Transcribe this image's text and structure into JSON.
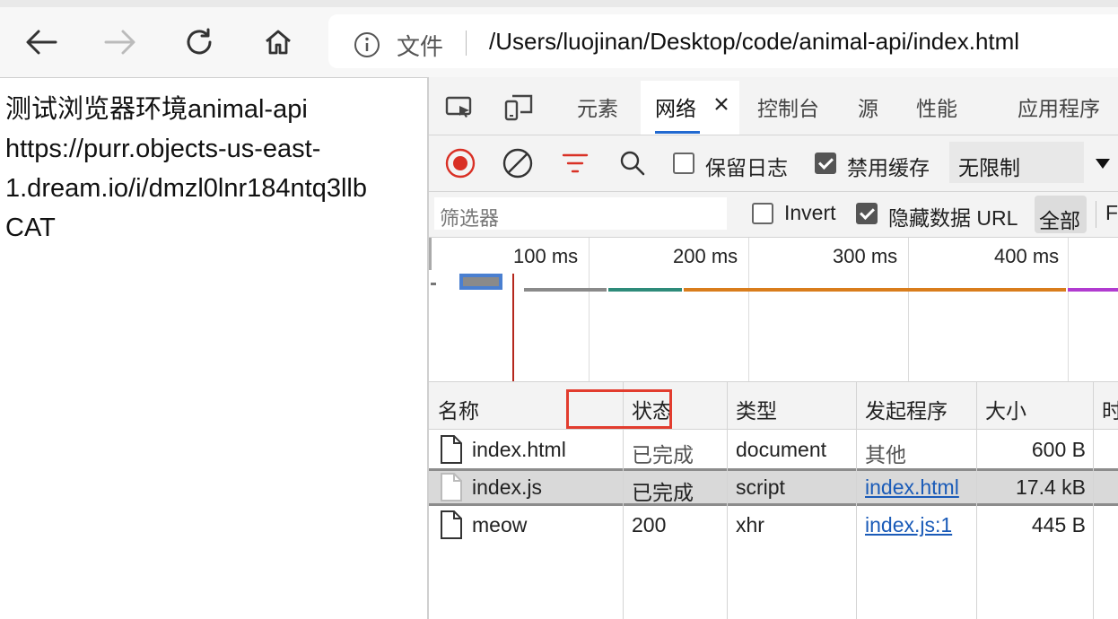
{
  "browser": {
    "address_prefix": "文件",
    "url": "/Users/luojinan/Desktop/code/animal-api/index.html"
  },
  "page": {
    "lines": [
      "测试浏览器环境animal-api",
      "https://purr.objects-us-east-",
      "1.dream.io/i/dmzl0lnr184ntq3llb",
      "CAT"
    ]
  },
  "devtools": {
    "tabs": [
      "元素",
      "网络",
      "控制台",
      "源",
      "性能",
      "应用程序"
    ],
    "active_tab": "网络",
    "toolbar": {
      "preserve_log": "保留日志",
      "preserve_log_checked": false,
      "disable_cache": "禁用缓存",
      "disable_cache_checked": true,
      "throttle": "无限制"
    },
    "filter": {
      "placeholder": "筛选器",
      "invert": "Invert",
      "invert_checked": false,
      "hide_data_url": "隐藏数据 URL",
      "hide_data_url_checked": true,
      "all": "全部",
      "next": "F"
    },
    "timeline": {
      "ticks": [
        "100 ms",
        "200 ms",
        "300 ms",
        "400 ms"
      ]
    },
    "table": {
      "columns": [
        "名称",
        "状态",
        "类型",
        "发起程序",
        "大小",
        "时"
      ],
      "rows": [
        {
          "name": "index.html",
          "status": "已完成",
          "type": "document",
          "initiator": "其他",
          "size": "600 B",
          "selected": false
        },
        {
          "name": "index.js",
          "status": "已完成",
          "type": "script",
          "initiator": "index.html",
          "size": "17.4 kB",
          "selected": true
        },
        {
          "name": "meow",
          "status": "200",
          "type": "xhr",
          "initiator": "index.js:1",
          "size": "445 B",
          "selected": false
        }
      ]
    }
  },
  "colors": {
    "accent": "#2169d0",
    "record": "#d93025",
    "highlight_box": "#e23c2e"
  }
}
